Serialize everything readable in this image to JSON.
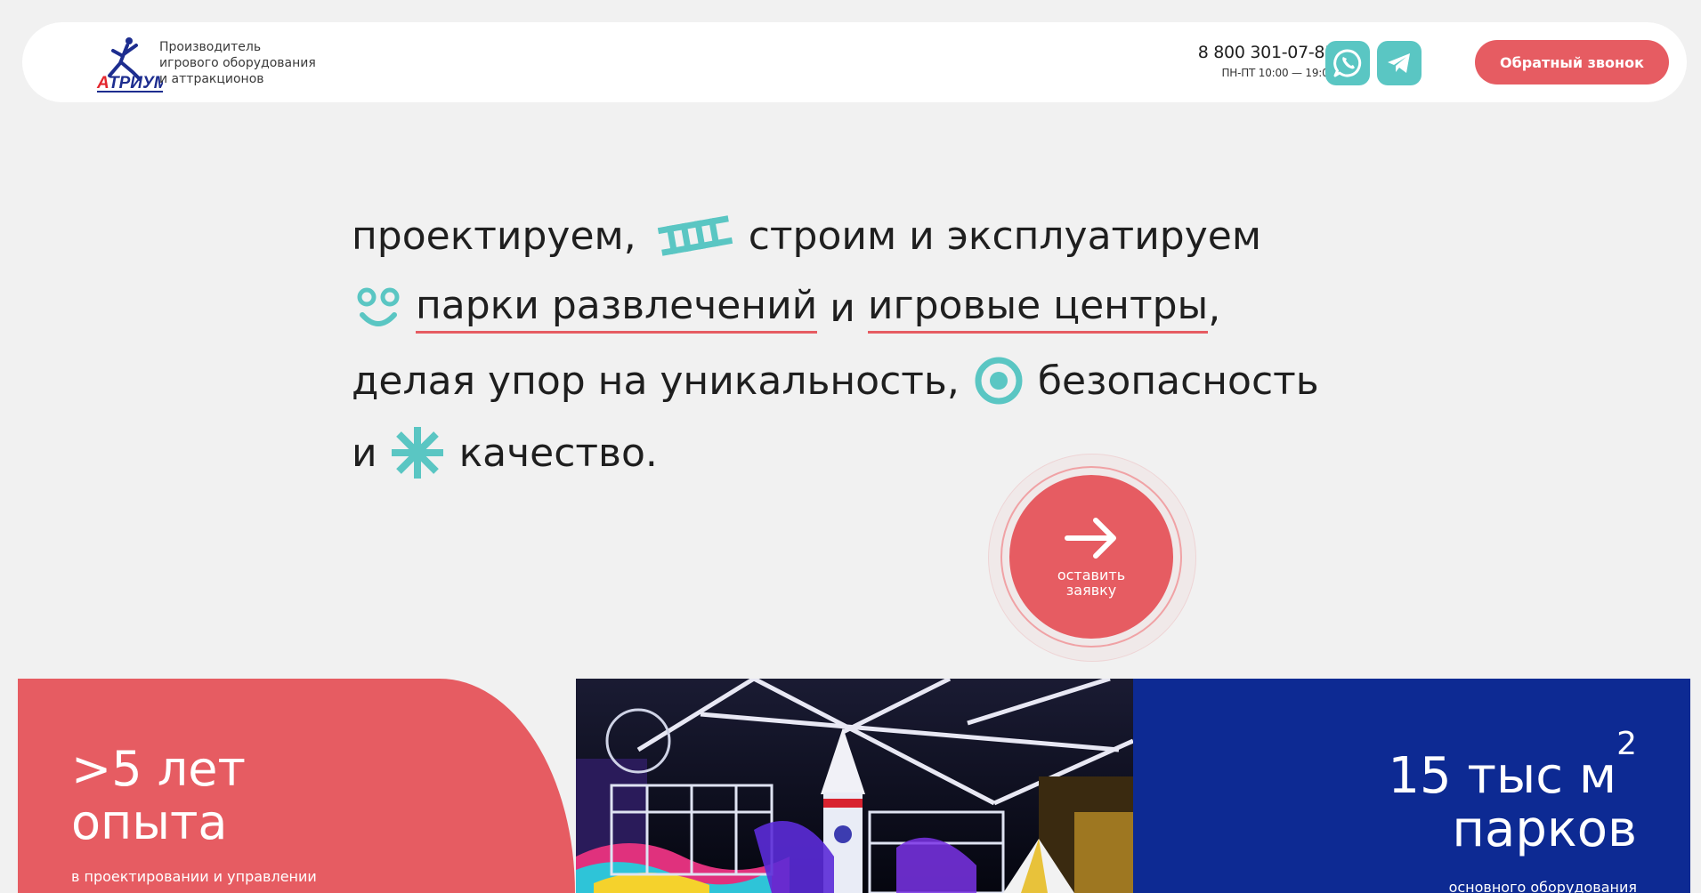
{
  "header": {
    "logo_text": "АТРИУМ",
    "tagline": [
      "Производитель",
      "игрового оборудования",
      "и аттракционов"
    ],
    "phone": "8 800 301-07-85",
    "hours": "ПН-ПТ 10:00 — 19:00",
    "callback_label": "Обратный звонок",
    "whatsapp_icon": "whatsapp-icon",
    "telegram_icon": "telegram-icon"
  },
  "hero": {
    "line1_a": "проектируем,",
    "line1_b": "строим и эксплуатируем",
    "line2_link1": "парки развлечений",
    "line2_mid": "и",
    "line2_link2": "игровые центры",
    "line2_end": ",",
    "line3_a": "делая упор на уникальность,",
    "line3_b": "безопасность",
    "line4_a": "и",
    "line4_b": "качество."
  },
  "cta": {
    "label": "оставить заявку"
  },
  "cards": {
    "experience_line1": ">5 лет",
    "experience_line2": "опыта",
    "experience_note": "в проектировании и управлении",
    "area_line1": "15 тыс м",
    "area_sup": "2",
    "area_line2": "парков",
    "area_note": "основного оборудования"
  },
  "colors": {
    "accent_red": "#e65c62",
    "accent_teal": "#5ac6c3",
    "brand_blue": "#0d2a93",
    "background": "#f1f1f1"
  }
}
